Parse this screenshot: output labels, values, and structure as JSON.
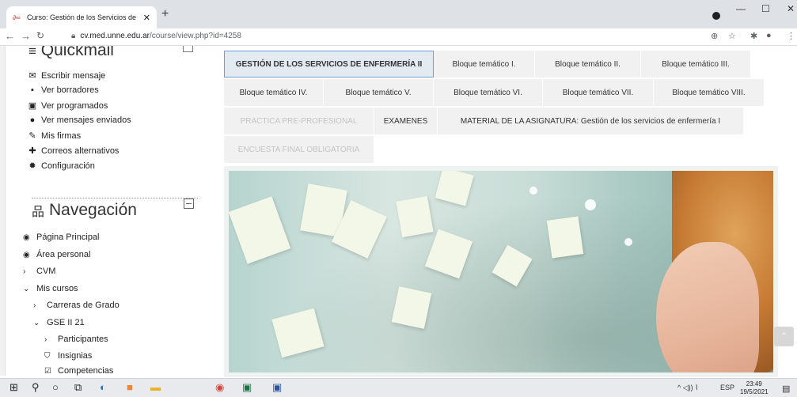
{
  "browser": {
    "tab_title": "Curso: Gestión de los Servicios de",
    "url_host": "cv.med.unne.edu.ar",
    "url_path": "/course/view.php?id=4258"
  },
  "sidebar": {
    "quickmail_title": "Quickmail",
    "quickmail_items": [
      {
        "label": "Escribir mensaje",
        "icon": "envelope-icon"
      },
      {
        "label": "Ver borradores",
        "icon": "draft-icon"
      },
      {
        "label": "Ver programados",
        "icon": "calendar-icon"
      },
      {
        "label": "Ver mensajes enviados",
        "icon": "comment-icon"
      },
      {
        "label": "Mis firmas",
        "icon": "pen-icon"
      },
      {
        "label": "Correos alternativos",
        "icon": "plus-icon"
      },
      {
        "label": "Configuración",
        "icon": "gear-icon"
      }
    ],
    "nav_title": "Navegación",
    "nav_items": [
      {
        "label": "Página Principal",
        "icon": "dashboard-icon"
      },
      {
        "label": "Área personal",
        "icon": "dashboard-icon"
      },
      {
        "label": "CVM",
        "icon": "chevron-right-icon"
      },
      {
        "label": "Mis cursos",
        "icon": "chevron-down-icon"
      },
      {
        "label": "Carreras de Grado",
        "icon": "chevron-right-icon"
      },
      {
        "label": "GSE II 21",
        "icon": "chevron-down-icon"
      },
      {
        "label": "Participantes",
        "icon": "chevron-right-icon"
      },
      {
        "label": "Insignias",
        "icon": "shield-icon"
      },
      {
        "label": "Competencias",
        "icon": "check-square-icon"
      }
    ]
  },
  "course_tabs": [
    {
      "label": "GESTIÓN DE LOS SERVICIOS DE ENFERMERÍA II",
      "state": "active"
    },
    {
      "label": "Bloque temático I.",
      "state": "normal"
    },
    {
      "label": "Bloque temático II.",
      "state": "normal"
    },
    {
      "label": "Bloque temático III.",
      "state": "normal"
    },
    {
      "label": "Bloque temático IV.",
      "state": "normal"
    },
    {
      "label": "Bloque temático V.",
      "state": "normal"
    },
    {
      "label": "Bloque temático VI.",
      "state": "normal"
    },
    {
      "label": "Bloque temático VII.",
      "state": "normal"
    },
    {
      "label": "Bloque temático VIII.",
      "state": "normal"
    },
    {
      "label": "PRACTICA PRE-PROFESIONAL",
      "state": "dim"
    },
    {
      "label": "EXAMENES",
      "state": "normal"
    },
    {
      "label": "MATERIAL DE LA ASIGNATURA: Gestión de los servicios de enfermería I",
      "state": "normal"
    },
    {
      "label": "ENCUESTA FINAL OBLIGATORIA",
      "state": "dim"
    }
  ],
  "taskbar": {
    "lang": "ESP",
    "time": "23:49",
    "date": "19/5/2021"
  },
  "colors": {
    "active_tab_border": "#6f9ed6",
    "active_tab_bg": "#e4eaf2",
    "tab_bg": "#f1f1f1"
  }
}
